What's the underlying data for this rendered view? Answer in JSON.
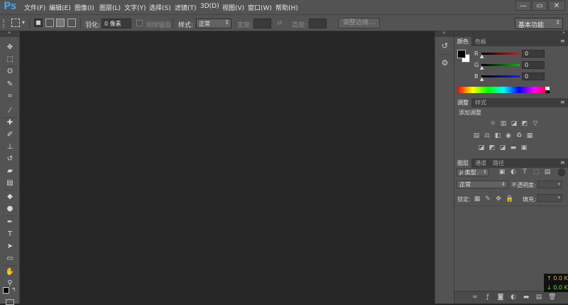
{
  "app": {
    "logo": "Ps",
    "menu": [
      "文件(F)",
      "编辑(E)",
      "图像(I)",
      "图层(L)",
      "文字(Y)",
      "选择(S)",
      "滤镜(T)",
      "3D(D)",
      "视图(V)",
      "窗口(W)",
      "帮助(H)"
    ],
    "window_controls": {
      "minimize": "—",
      "restore": "▭",
      "close": "✕"
    }
  },
  "options_bar": {
    "feather_label": "羽化:",
    "feather_value": "0 像素",
    "antialias_label": "消除锯齿",
    "style_label": "样式:",
    "style_value": "正常",
    "width_label": "宽度:",
    "height_label": "高度:",
    "refine_edge": "调整边缘...",
    "workspace": "基本功能"
  },
  "tools": [
    {
      "name": "move-tool",
      "glyph": "✥"
    },
    {
      "name": "marquee-tool",
      "glyph": "⬚"
    },
    {
      "name": "lasso-tool",
      "glyph": "ʘ"
    },
    {
      "name": "quick-select-tool",
      "glyph": "✎"
    },
    {
      "name": "crop-tool",
      "glyph": "⌗"
    },
    {
      "name": "eyedropper-tool",
      "glyph": "⁄"
    },
    {
      "name": "healing-brush-tool",
      "glyph": "✚"
    },
    {
      "name": "brush-tool",
      "glyph": "✐"
    },
    {
      "name": "clone-stamp-tool",
      "glyph": "⊥"
    },
    {
      "name": "history-brush-tool",
      "glyph": "↺"
    },
    {
      "name": "eraser-tool",
      "glyph": "▰"
    },
    {
      "name": "gradient-tool",
      "glyph": "▤"
    },
    {
      "name": "blur-tool",
      "glyph": "◆"
    },
    {
      "name": "dodge-tool",
      "glyph": "●"
    },
    {
      "name": "pen-tool",
      "glyph": "✒"
    },
    {
      "name": "type-tool",
      "glyph": "T"
    },
    {
      "name": "path-select-tool",
      "glyph": "➤"
    },
    {
      "name": "shape-tool",
      "glyph": "▭"
    },
    {
      "name": "hand-tool",
      "glyph": "✋"
    },
    {
      "name": "zoom-tool",
      "glyph": "⚲"
    }
  ],
  "color_panel": {
    "tabs": [
      "颜色",
      "色板"
    ],
    "channels": [
      {
        "label": "R",
        "value": "0",
        "color": "#c81e1e"
      },
      {
        "label": "G",
        "value": "0",
        "color": "#1ea51e"
      },
      {
        "label": "B",
        "value": "0",
        "color": "#1e1ed2"
      }
    ],
    "foreground": "#000000",
    "background": "#ffffff"
  },
  "adjustments_panel": {
    "tabs": [
      "调整",
      "样式"
    ],
    "title": "添加调整"
  },
  "layers_panel": {
    "tabs": [
      "图层",
      "通道",
      "路径"
    ],
    "filter_label": "ρ 类型",
    "blend_mode": "正常",
    "opacity_label": "不透明度:",
    "lock_label": "锁定:",
    "fill_label": "填充:"
  },
  "net_meter": {
    "up": "↑ 0.0 K",
    "down": "↓ 0.0 K",
    "up_color": "#e8a33a",
    "down_color": "#7fd44c"
  }
}
